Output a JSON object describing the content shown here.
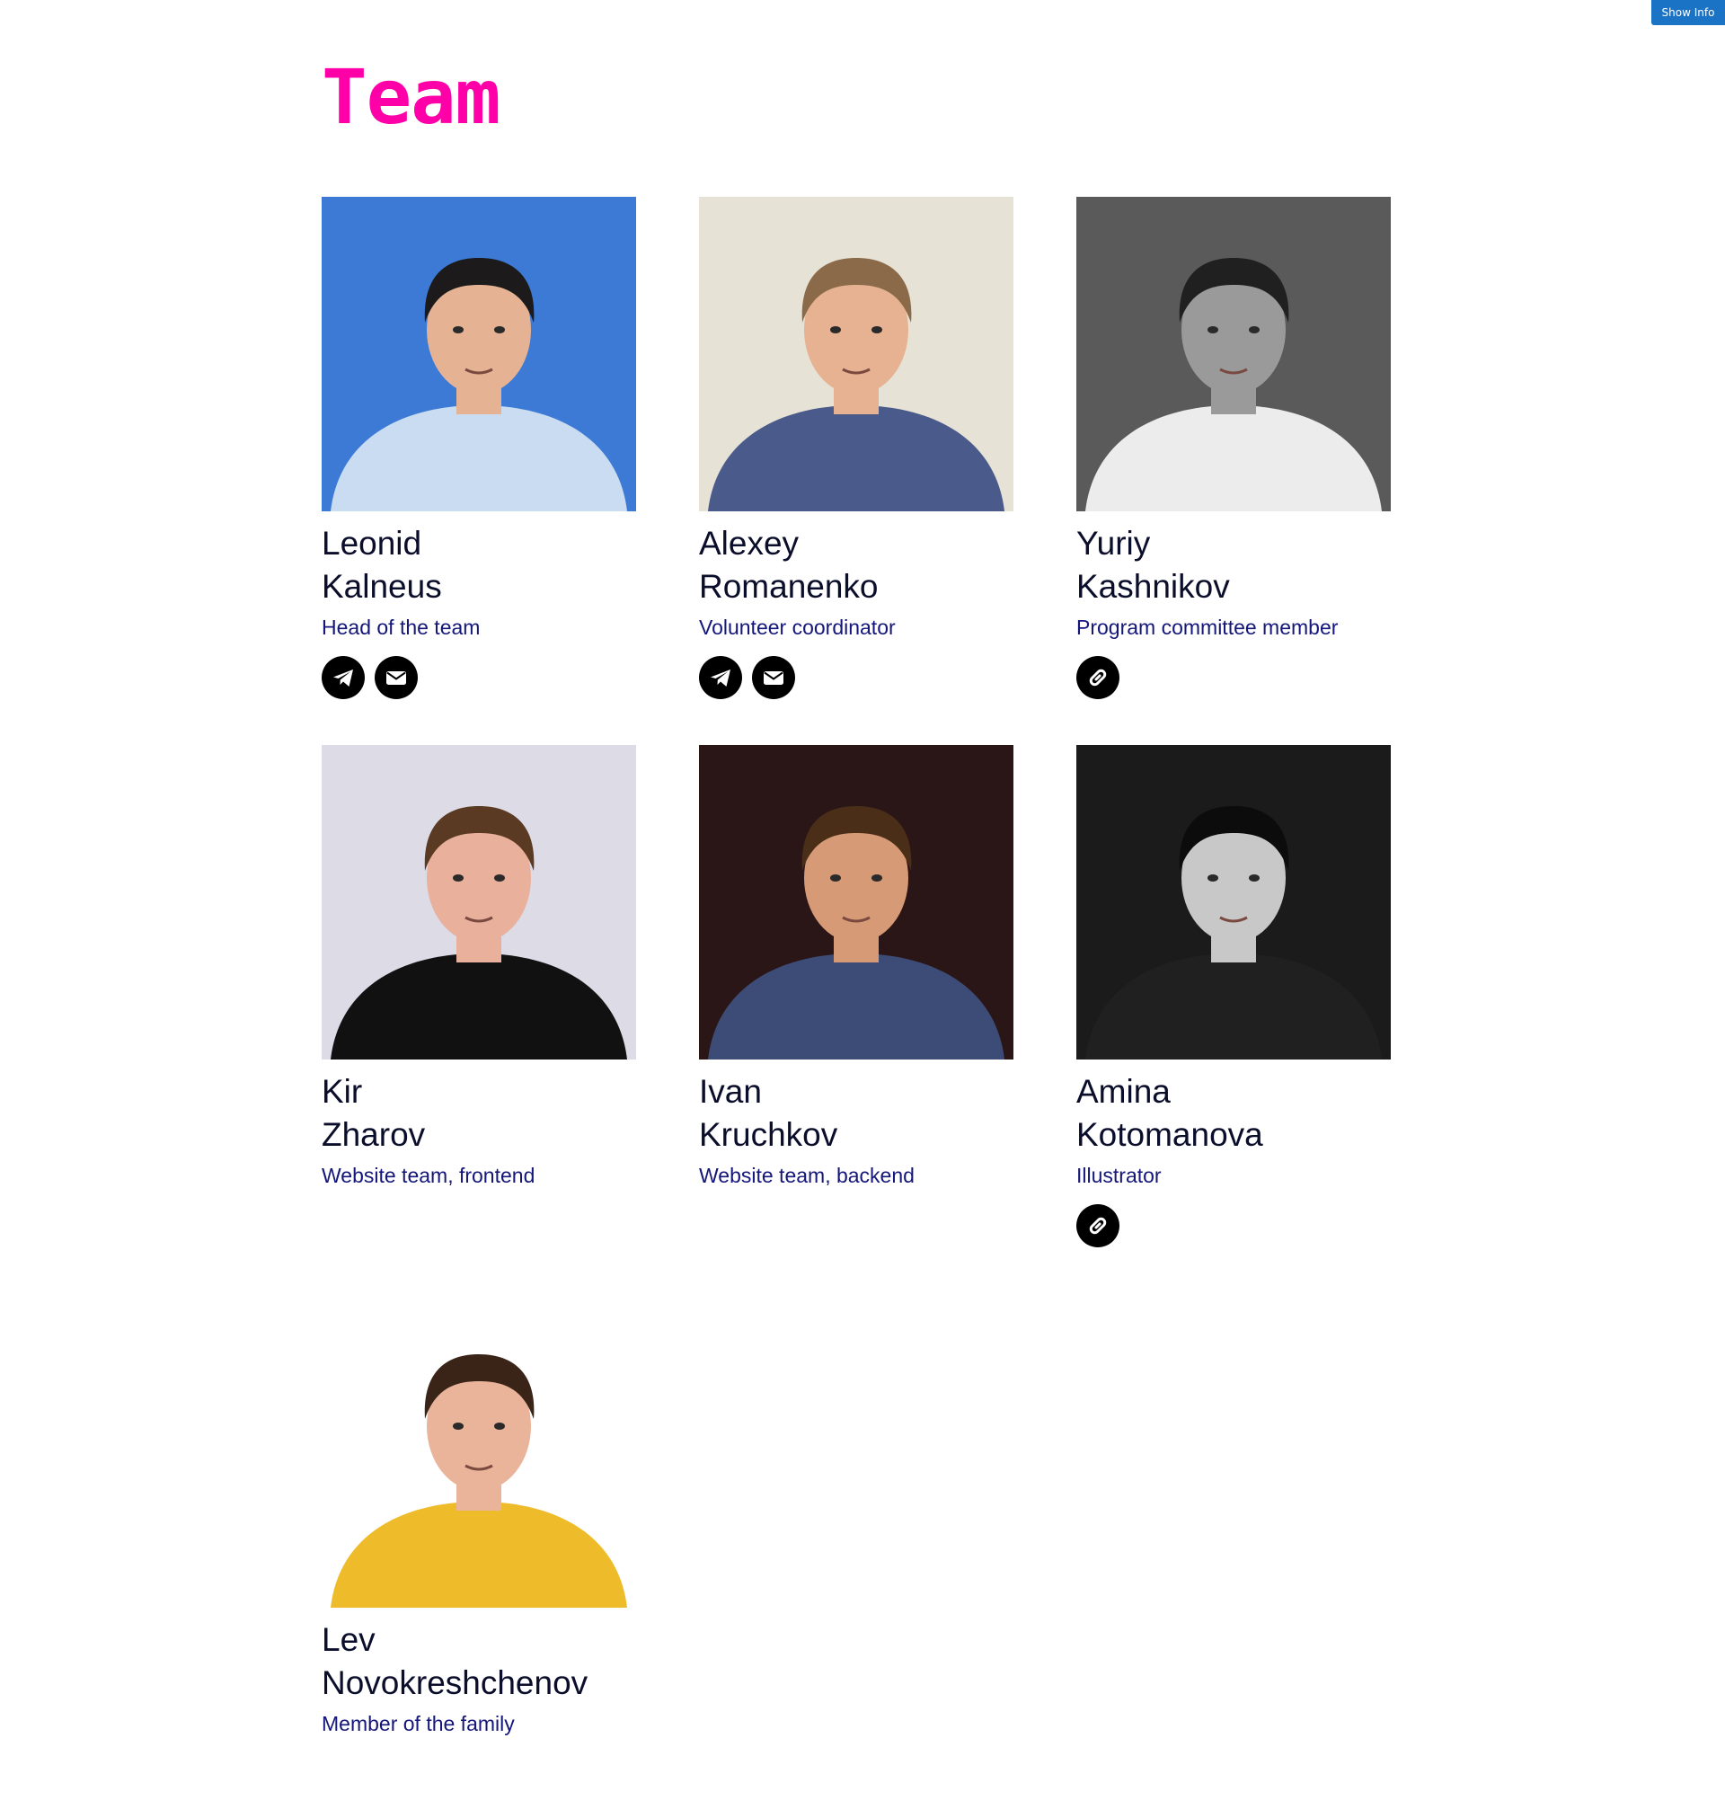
{
  "toolbar": {
    "show_info_label": "Show Info"
  },
  "page": {
    "title": "Team"
  },
  "members": [
    {
      "first_name": "Leonid",
      "last_name": "Kalneus",
      "role": "Head of the team",
      "links": [
        "telegram-icon",
        "mail-icon"
      ],
      "photo": {
        "bg": "#3c7ad6",
        "shirt": "#c9dcf2",
        "skin": "#e5b393",
        "hair": "#1c1a1a",
        "style": "color"
      }
    },
    {
      "first_name": "Alexey",
      "last_name": "Romanenko",
      "role": "Volunteer coordinator",
      "links": [
        "telegram-icon",
        "mail-icon"
      ],
      "photo": {
        "bg": "#e6e2d6",
        "shirt": "#4a5a8a",
        "skin": "#e6b291",
        "hair": "#8a6a48",
        "style": "color"
      }
    },
    {
      "first_name": "Yuriy",
      "last_name": "Kashnikov",
      "role": "Program committee member",
      "links": [
        "chain-link-icon"
      ],
      "photo": {
        "bg": "#5a5a5a",
        "shirt": "#ececec",
        "skin": "#9a9a9a",
        "hair": "#202020",
        "style": "mono"
      }
    },
    {
      "first_name": "Kir",
      "last_name": "Zharov",
      "role": "Website team, frontend",
      "links": [],
      "photo": {
        "bg": "#dcdbe6",
        "shirt": "#111111",
        "skin": "#e9b09c",
        "hair": "#5a3a22",
        "style": "color"
      }
    },
    {
      "first_name": "Ivan",
      "last_name": "Kruchkov",
      "role": "Website team, backend",
      "links": [],
      "photo": {
        "bg": "#2a1616",
        "shirt": "#3d4c76",
        "skin": "#d79a76",
        "hair": "#4a2e18",
        "style": "color"
      }
    },
    {
      "first_name": "Amina",
      "last_name": "Kotomanova",
      "role": "Illustrator",
      "links": [
        "chain-link-icon"
      ],
      "photo": {
        "bg": "#1b1b1b",
        "shirt": "#202020",
        "skin": "#c8c8c8",
        "hair": "#0c0c0c",
        "style": "mono"
      }
    },
    {
      "first_name": "Lev",
      "last_name": "Novokreshchenov",
      "role": "Member of the family",
      "links": [],
      "photo": {
        "bg": "#ffffff",
        "shirt": "#eebb2a",
        "skin": "#e9b49a",
        "hair": "#3a2418",
        "style": "color"
      }
    }
  ]
}
